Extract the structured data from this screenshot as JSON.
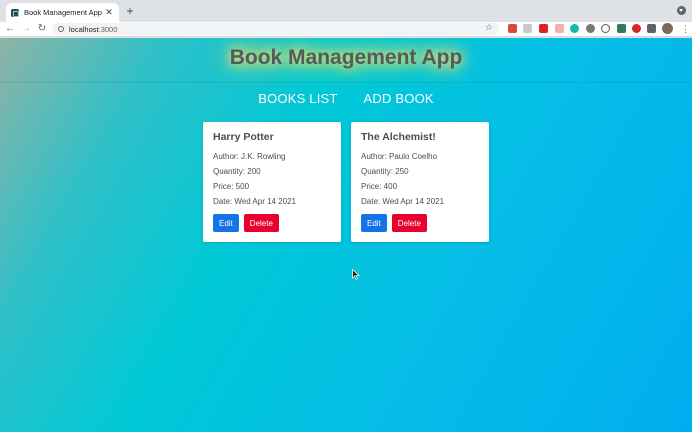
{
  "browser": {
    "tab_title": "Book Management App",
    "tab_close": "✕",
    "new_tab": "+",
    "url_host": "localhost",
    "url_port": ":3000",
    "back": "←",
    "forward": "→",
    "reload": "↻",
    "bookmark": "☆",
    "menu": "⋮"
  },
  "app": {
    "title": "Book Management App",
    "nav": [
      {
        "label": "BOOKS LIST"
      },
      {
        "label": "ADD BOOK"
      }
    ]
  },
  "books": [
    {
      "title": "Harry Potter",
      "author": "Author: J.K. Rowling",
      "quantity": "Quantity: 200",
      "price": "Price: 500",
      "date": "Date: Wed Apr 14 2021",
      "edit_label": "Edit",
      "delete_label": "Delete"
    },
    {
      "title": "The Alchemist!",
      "author": "Author: Paulo Coelho",
      "quantity": "Quantity: 250",
      "price": "Price: 400",
      "date": "Date: Wed Apr 14 2021",
      "edit_label": "Edit",
      "delete_label": "Delete"
    }
  ],
  "colors": {
    "edit": "#1473e6",
    "delete": "#e8002f",
    "title_glow": "#f4e86a"
  }
}
